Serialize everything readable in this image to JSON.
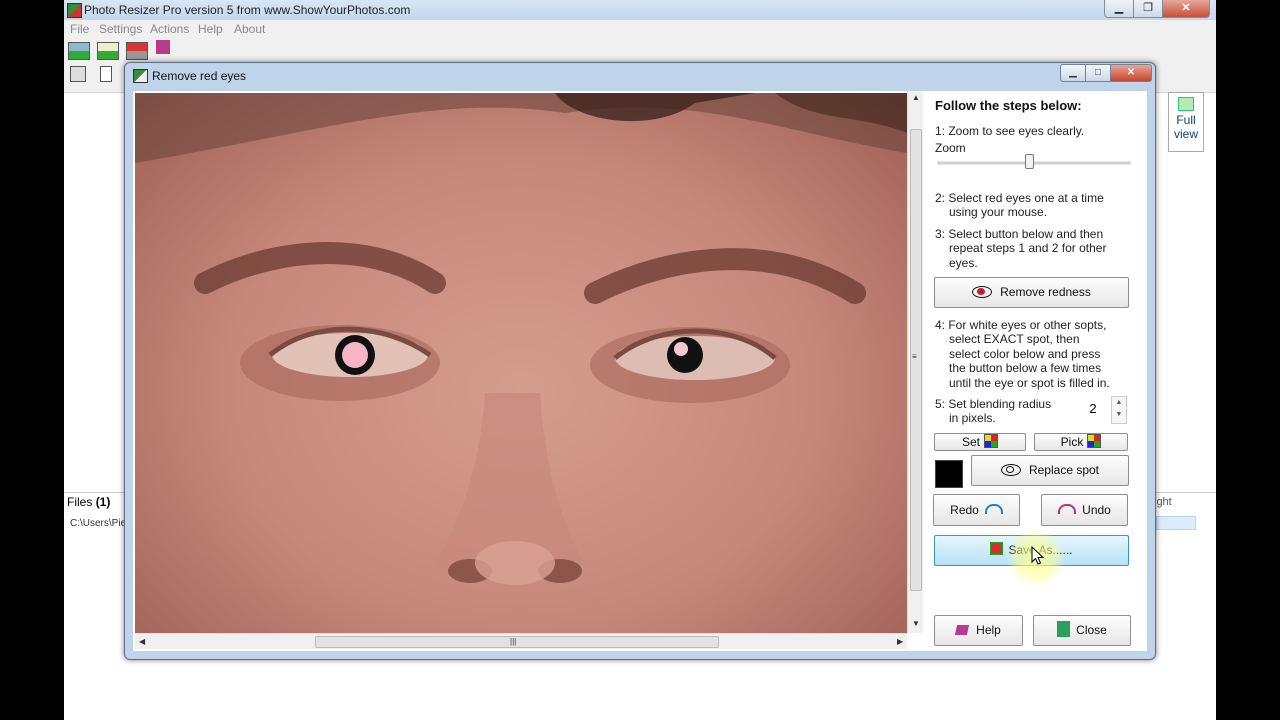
{
  "app": {
    "title": "Photo Resizer Pro version 5 from www.ShowYourPhotos.com",
    "window_buttons": {
      "minimize": "▁",
      "maximize": "❐",
      "close": "✕"
    },
    "menu": [
      "File",
      "Settings",
      "Actions",
      "Help",
      "About"
    ],
    "full_view": {
      "line1": "Full",
      "line2": "view"
    },
    "files_label": "Files",
    "files_count": "(1)",
    "file_path": "C:\\Users\\Pie",
    "column_partial": "ight"
  },
  "dialog": {
    "title": "Remove red eyes",
    "window_buttons": {
      "minimize": "▁",
      "maximize": "□",
      "close": "✕"
    },
    "steps_heading": "Follow the steps below:",
    "step1": "1: Zoom to see eyes clearly.",
    "zoom_label": "Zoom",
    "zoom_level": 0.48,
    "step2_line1": "2:  Select red eyes one at a time",
    "step2_line2": "using your mouse.",
    "step3_line1": "3:  Select button below and then",
    "step3_line2": "repeat steps 1 and 2 for other",
    "step3_line3": "eyes.",
    "remove_redness": "Remove redness",
    "step4_line1": "4:  For white eyes or other sopts,",
    "step4_line2": "select EXACT spot, then",
    "step4_line3": "select color below and press",
    "step4_line4": "the button below a few times",
    "step4_line5": "until the eye or spot is filled in.",
    "step5_line1": "5:  Set blending radius",
    "step5_line2": "in pixels.",
    "blend_radius": "2",
    "set": "Set",
    "pick": "Pick",
    "selected_color": "#000000",
    "replace_spot": "Replace spot",
    "redo": "Redo",
    "undo": "Undo",
    "save_as": "Save As......",
    "help": "Help",
    "close": "Close",
    "scroll_arrows": {
      "up": "▲",
      "down": "▼",
      "left": "◀",
      "right": "▶",
      "grip": "≡",
      "hgrip": "|||"
    },
    "spin_arrows": {
      "up": "▲",
      "down": "▼"
    }
  },
  "colors": {
    "accent": "#3d8fc4",
    "red_eye_icon": "#c0202b",
    "skin": "#c6887b"
  }
}
